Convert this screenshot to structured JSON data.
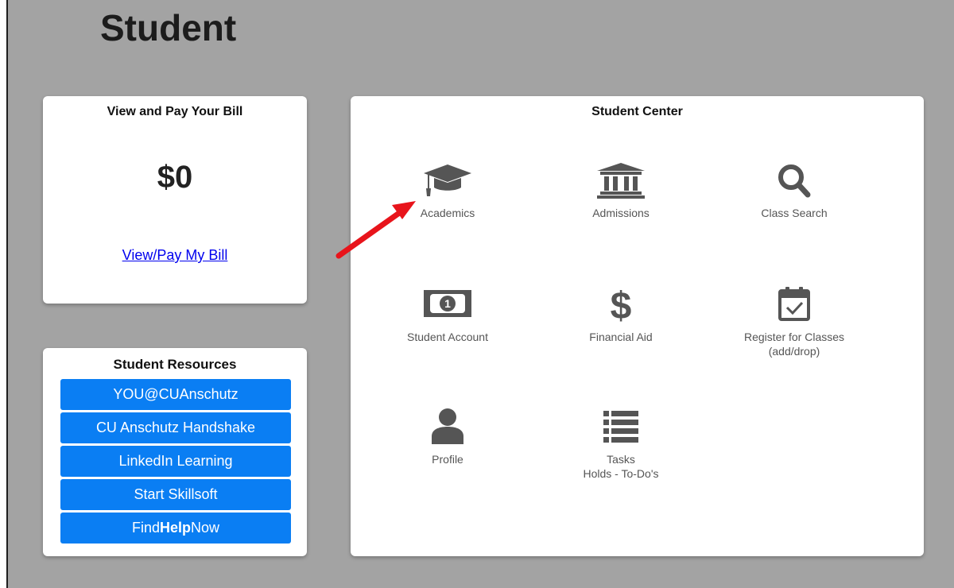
{
  "page": {
    "title": "Student"
  },
  "bill": {
    "title": "View and Pay Your Bill",
    "amount": "$0",
    "link_label": "View/Pay My Bill"
  },
  "resources": {
    "title": "Student Resources",
    "items": [
      {
        "label": "YOU@CUAnschutz"
      },
      {
        "label": "CU Anschutz Handshake"
      },
      {
        "label": "LinkedIn Learning"
      },
      {
        "label": "Start Skillsoft"
      },
      {
        "label_prefix": "Find",
        "label_bold": "Help",
        "label_suffix": "Now"
      }
    ]
  },
  "center": {
    "title": "Student Center",
    "tiles": [
      {
        "icon": "graduation-cap-icon",
        "label": "Academics",
        "label2": ""
      },
      {
        "icon": "institution-icon",
        "label": "Admissions",
        "label2": ""
      },
      {
        "icon": "magnifier-icon",
        "label": "Class Search",
        "label2": ""
      },
      {
        "icon": "money-bill-icon",
        "label": "Student Account",
        "label2": ""
      },
      {
        "icon": "dollar-sign-icon",
        "label": "Financial Aid",
        "label2": ""
      },
      {
        "icon": "calendar-check-icon",
        "label": "Register for Classes",
        "label2": "(add/drop)"
      },
      {
        "icon": "user-icon",
        "label": "Profile",
        "label2": ""
      },
      {
        "icon": "list-icon",
        "label": "Tasks",
        "label2": "Holds - To-Do's"
      }
    ]
  },
  "annotation": {
    "arrow_color": "#e8141b",
    "points_to": "Academics"
  },
  "colors": {
    "background": "#a3a3a3",
    "resource_button": "#0a7ef3",
    "icon": "#555555",
    "link": "#0000ee"
  }
}
